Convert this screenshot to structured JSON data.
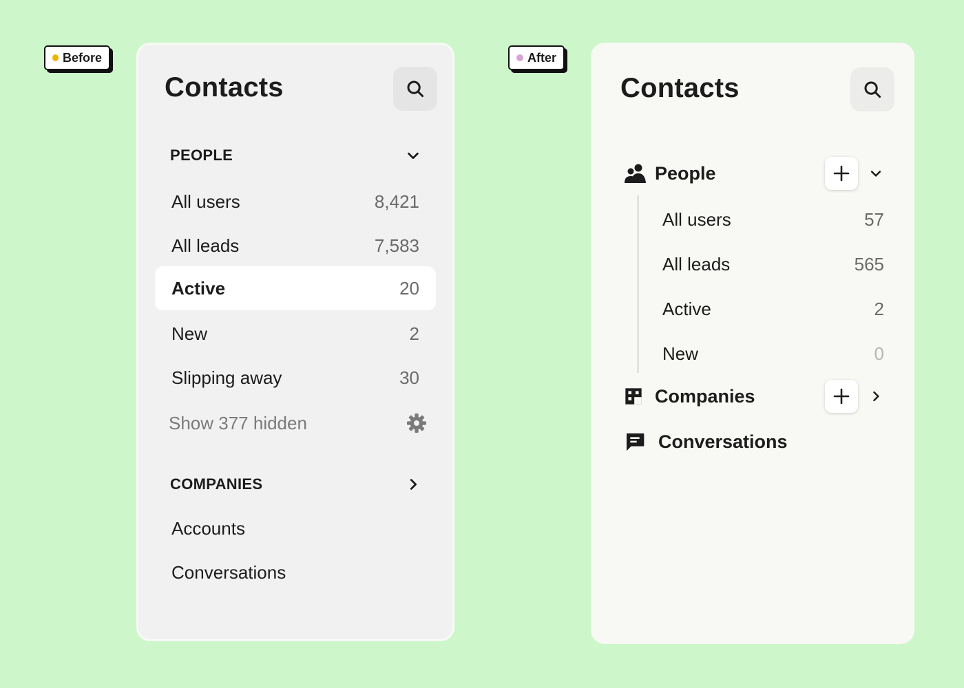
{
  "before": {
    "badge": {
      "label": "Before",
      "dot_color": "#f0b400"
    },
    "title": "Contacts",
    "people": {
      "heading": "PEOPLE",
      "items": [
        {
          "label": "All users",
          "count": "8,421"
        },
        {
          "label": "All leads",
          "count": "7,583"
        },
        {
          "label": "Active",
          "count": "20",
          "selected": true
        },
        {
          "label": "New",
          "count": "2"
        },
        {
          "label": "Slipping away",
          "count": "30"
        }
      ],
      "show_hidden": "Show 377 hidden"
    },
    "companies": {
      "heading": "COMPANIES",
      "items": [
        "Accounts",
        "Conversations"
      ]
    }
  },
  "after": {
    "badge": {
      "label": "After",
      "dot_color": "#d9a3d6"
    },
    "title": "Contacts",
    "people": {
      "label": "People",
      "items": [
        {
          "label": "All users",
          "count": "57"
        },
        {
          "label": "All leads",
          "count": "565"
        },
        {
          "label": "Active",
          "count": "2"
        },
        {
          "label": "New",
          "count": "0"
        }
      ]
    },
    "companies": {
      "label": "Companies"
    },
    "conversations": {
      "label": "Conversations"
    }
  },
  "icons": {
    "search": "search-icon",
    "chevron_down": "chevron-down-icon",
    "chevron_right": "chevron-right-icon",
    "gear": "gear-icon",
    "people": "people-icon",
    "building": "building-icon",
    "chat": "chat-icon",
    "plus": "plus-icon"
  },
  "colors": {
    "background": "#cdf7cb",
    "before_panel": "#f1f1f1",
    "after_panel": "#f8f8f4",
    "selected_row": "#ffffff"
  }
}
